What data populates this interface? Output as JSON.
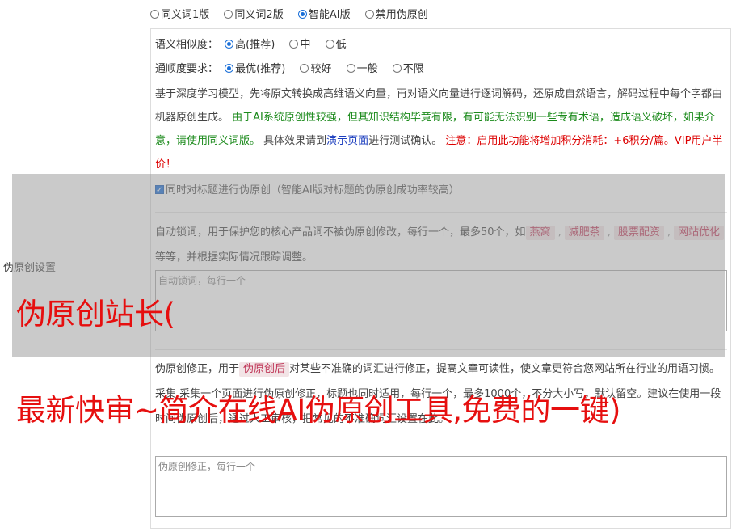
{
  "mode_options": [
    {
      "label": "同义词1版",
      "selected": false
    },
    {
      "label": "同义词2版",
      "selected": false
    },
    {
      "label": "智能AI版",
      "selected": true
    },
    {
      "label": "禁用伪原创",
      "selected": false
    }
  ],
  "similarity": {
    "label": "语义相似度：",
    "options": [
      {
        "label": "高(推荐)",
        "selected": true
      },
      {
        "label": "中",
        "selected": false
      },
      {
        "label": "低",
        "selected": false
      }
    ]
  },
  "fluency": {
    "label": "通顺度要求：",
    "options": [
      {
        "label": "最优(推荐)",
        "selected": true
      },
      {
        "label": "较好",
        "selected": false
      },
      {
        "label": "一般",
        "selected": false
      },
      {
        "label": "不限",
        "selected": false
      }
    ]
  },
  "description": {
    "intro": "基于深度学习模型，先将原文转换成高维语义向量，再对语义向量进行逐词解码，还原成自然语言，解码过程中每个字都由机器原创生成。",
    "green_note": "由于AI系统原创性较强，但其知识结构毕竟有限，有可能无法识别一些专有术语，造成语义破坏，如果介意，请使用同义词版。",
    "effect_prefix": "具体效果请到",
    "demo_link": "演示页面",
    "effect_suffix": "进行测试确认。",
    "red_note": "注意：启用此功能将增加积分消耗：+6积分/篇。VIP用户半价！"
  },
  "title_checkbox": {
    "label": "同时对标题进行伪原创（智能AI版对标题的伪原创成功率较高）",
    "checked": true
  },
  "side_label": "伪原创设置",
  "lock_words": {
    "desc_prefix": "自动锁词，用于保护您的核心产品词不被伪原创修改，每行一个，最多50个，如",
    "tags": [
      "燕窝",
      "减肥茶",
      "股票配资",
      "网站优化"
    ],
    "desc_suffix": "等等，并根据实际情况跟踪调整。",
    "placeholder": "自动锁词，每行一个"
  },
  "correction": {
    "desc_prefix": "伪原创修正，用于",
    "tag": "伪原创后",
    "desc_mid": "对某些不准确的词汇进行修正，提高文章可读性，使文章更符合您网站所在行业的用语习惯。",
    "desc_hidden": "采集 采集一个页面进行伪原创修正，标题也同时适用，每行一",
    "desc_tail": "个，最多1000个，不分大小写，默认留空。建议在使用一段时间伪原创后，通过人工审核，把常见的不准确词汇设置在此。",
    "placeholder": "伪原创修正，每行一个"
  },
  "watermark": {
    "line1": "伪原创站长(",
    "line2": "最新快审~简介在线AI伪原创工具,免费的一键)"
  }
}
